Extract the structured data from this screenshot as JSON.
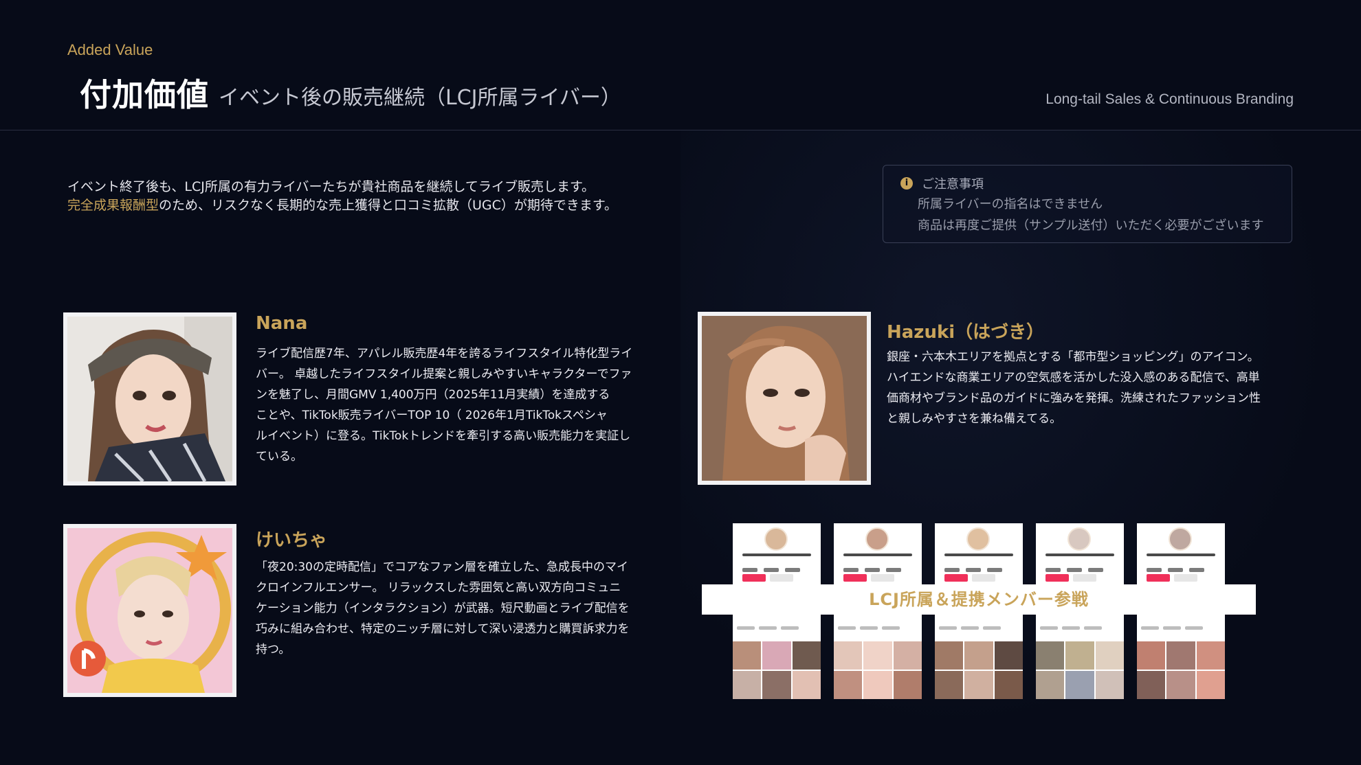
{
  "header": {
    "eyebrow": "Added Value",
    "title": "付加価値",
    "subtitle": "イベント後の販売継続（LCJ所属ライバー）",
    "tagline": "Long-tail Sales & Continuous Branding"
  },
  "intro": {
    "line1": "イベント終了後も、LCJ所属の有力ライバーたちが貴社商品を継続してライブ販売します。",
    "highlight": "完全成果報酬型",
    "line2_rest": "のため、リスクなく長期的な売上獲得と口コミ拡散（UGC）が期待できます。"
  },
  "notice": {
    "icon": "info-icon",
    "title": "ご注意事項",
    "items": [
      "所属ライバーの指名はできません",
      "商品は再度ご提供（サンプル送付）いただく必要がございます"
    ]
  },
  "livers": [
    {
      "name": "Nana",
      "lines": [
        "ライブ配信歴7年、アパレル販売歴4年を誇るライフスタイル特化型ライ",
        "バー。 卓越したライフスタイル提案と親しみやすいキャラクターでファ",
        "ンを魅了し、月間GMV 1,400万円（2025年11月実績）を達成する",
        "ことや、TikTok販売ライバーTOP 10（ 2026年1月TikTokスペシャ",
        "ルイベント）に登る。TikTokトレンドを牽引する高い販売能力を実証し",
        "ている。"
      ]
    },
    {
      "name": "Hazuki（はづき）",
      "lines": [
        "銀座・六本木エリアを拠点とする「都市型ショッピング」のアイコン。",
        "ハイエンドな商業エリアの空気感を活かした没入感のある配信で、高単",
        "価商材やブランド品のガイドに強みを発揮。洗練されたファッション性",
        "と親しみやすさを兼ね備えてる。"
      ]
    },
    {
      "name": "けいちゃ",
      "lines": [
        "「夜20:30の定時配信」でコアなファン層を確立した、急成長中のマイ",
        "クロインフルエンサー。 リラックスした雰囲気と高い双方向コミュニ",
        "ケーション能力（インタラクション）が武器。短尺動画とライブ配信を",
        "巧みに組み合わせ、特定のニッチ層に対して深い浸透力と購買訴求力を",
        "持つ。"
      ]
    }
  ],
  "collage": {
    "banner": "LCJ所属＆提携メンバー参戦"
  },
  "colors": {
    "background": "#070b18",
    "accent_gold": "#c9a45a",
    "tiktok_red": "#f0305a"
  }
}
